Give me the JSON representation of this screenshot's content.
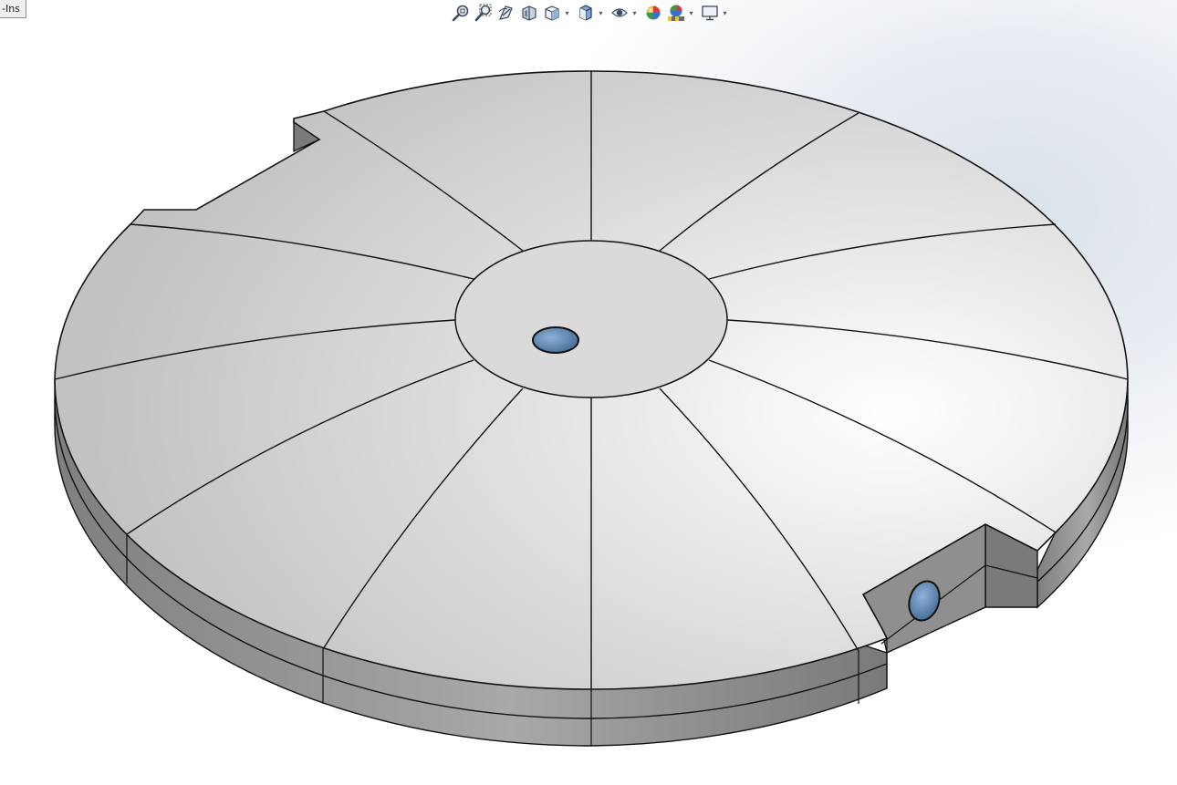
{
  "tab": {
    "label": "-Ins"
  },
  "toolbar": {
    "tools": [
      {
        "id": "zoom-to-fit",
        "icon": "zoom-to-fit-icon"
      },
      {
        "id": "zoom-to-area",
        "icon": "zoom-to-area-icon"
      },
      {
        "id": "previous-view",
        "icon": "previous-view-icon"
      },
      {
        "id": "section-view",
        "icon": "section-view-icon"
      },
      {
        "id": "view-orientation",
        "icon": "view-orientation-icon",
        "dropdown": true
      },
      {
        "id": "display-style",
        "icon": "display-style-icon",
        "dropdown": true
      },
      {
        "id": "hide-show-items",
        "icon": "hide-show-eye-icon",
        "dropdown": true
      },
      {
        "id": "edit-appearance",
        "icon": "appearance-sphere-icon"
      },
      {
        "id": "apply-scene",
        "icon": "scene-icon",
        "dropdown": true
      },
      {
        "id": "view-settings",
        "icon": "monitor-icon",
        "dropdown": true
      }
    ]
  },
  "colors": {
    "face_light": "#eeeeee",
    "face_mid": "#cfcfcf",
    "side": "#8d8d8d",
    "hole": "#5a7ea8",
    "edge": "#111111"
  }
}
